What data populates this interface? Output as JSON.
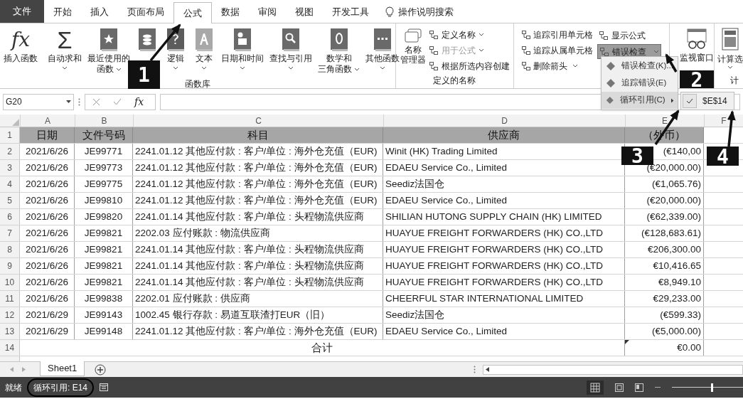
{
  "tabs": [
    {
      "label": "文件",
      "kind": "file",
      "selected": false
    },
    {
      "label": "开始",
      "kind": "tab",
      "selected": false
    },
    {
      "label": "插入",
      "kind": "tab",
      "selected": false
    },
    {
      "label": "页面布局",
      "kind": "tab",
      "selected": false
    },
    {
      "label": "公式",
      "kind": "tab",
      "selected": true
    },
    {
      "label": "数据",
      "kind": "tab",
      "selected": false
    },
    {
      "label": "审阅",
      "kind": "tab",
      "selected": false
    },
    {
      "label": "视图",
      "kind": "tab",
      "selected": false
    },
    {
      "label": "开发工具",
      "kind": "tab",
      "selected": false
    }
  ],
  "search_hint": "操作说明搜索",
  "function_library": {
    "label": "函数库",
    "buttons": [
      {
        "label": "插入函数",
        "glyph": "fx",
        "caret": false
      },
      {
        "label": "自动求和",
        "glyph": "Σ",
        "caret": true
      },
      {
        "label": "最近使用的",
        "label_2": "函数",
        "caret": true
      },
      {
        "caret": false
      },
      {
        "label": "逻辑",
        "caret": true
      },
      {
        "label": "文本",
        "caret": true
      },
      {
        "label": "日期和时间",
        "caret": true
      },
      {
        "label": "查找与引用",
        "caret": true
      },
      {
        "label": "数学和",
        "label_2": "三角函数",
        "caret": true
      },
      {
        "label": "其他函数",
        "caret": true
      }
    ]
  },
  "defined_names": {
    "label": "定义的名称",
    "manager": [
      "名称",
      "管理器"
    ],
    "items": [
      {
        "label": "定义名称",
        "caret": true,
        "disabled": false
      },
      {
        "label": "用于公式",
        "caret": true,
        "disabled": true
      },
      {
        "label": "根据所选内容创建",
        "caret": false,
        "disabled": false
      }
    ]
  },
  "auditing": {
    "left": [
      {
        "label": "追踪引用单元格",
        "caret": false
      },
      {
        "label": "追踪从属单元格",
        "caret": false
      },
      {
        "label": "删除箭头",
        "caret": true
      }
    ],
    "right": [
      {
        "label": "显示公式",
        "caret": false,
        "pressed": false
      },
      {
        "label": "错误检查",
        "caret": true,
        "pressed": true
      }
    ]
  },
  "watch_window": "监视窗口",
  "calculation": {
    "label": "计算选",
    "group_label": "计"
  },
  "error_menu": {
    "items": [
      {
        "label": "错误检查(K)...",
        "submenu": false
      },
      {
        "label": "追踪错误(E)",
        "submenu": false
      },
      {
        "label": "循环引用(C)",
        "submenu": true
      }
    ],
    "submenu": [
      {
        "label": "$E$14",
        "checked": true
      }
    ]
  },
  "formula_bar": {
    "name_box": "G20",
    "fx": "fx"
  },
  "columns": [
    "A",
    "B",
    "C",
    "D",
    "E",
    "F"
  ],
  "rows": [
    {
      "number": "1",
      "kind": "header",
      "cells": [
        "日期",
        "文件号码",
        "科目",
        "供应商",
        "（外币）"
      ]
    },
    {
      "number": "2",
      "kind": "data",
      "cells": [
        "2021/6/26",
        "JE99771",
        "2241.01.12 其他应付款 : 客户/单位 : 海外仓充值（EUR)",
        "Winit (HK) Trading Limited",
        "(€140,00"
      ]
    },
    {
      "number": "3",
      "kind": "data",
      "cells": [
        "2021/6/26",
        "JE99773",
        "2241.01.12 其他应付款 : 客户/单位 : 海外仓充值（EUR)",
        "EDAEU Service Co., Limited",
        "(€20,000.00)"
      ]
    },
    {
      "number": "4",
      "kind": "data",
      "cells": [
        "2021/6/26",
        "JE99775",
        "2241.01.12 其他应付款 : 客户/单位 : 海外仓充值（EUR)",
        "Seediz法国仓",
        "(€1,065.76)"
      ]
    },
    {
      "number": "5",
      "kind": "data",
      "cells": [
        "2021/6/26",
        "JE99810",
        "2241.01.12 其他应付款 : 客户/单位 : 海外仓充值（EUR)",
        "EDAEU Service Co., Limited",
        "(€20,000.00)"
      ]
    },
    {
      "number": "6",
      "kind": "data",
      "cells": [
        "2021/6/26",
        "JE99820",
        "2241.01.14 其他应付款 : 客户/单位 : 头程物流供应商",
        "SHILIAN HUTONG SUPPLY CHAIN (HK) LIMITED",
        "(€62,339.00)"
      ]
    },
    {
      "number": "7",
      "kind": "data",
      "cells": [
        "2021/6/26",
        "JE99821",
        "2202.03 应付账款 : 物流供应商",
        "HUAYUE FREIGHT FORWARDERS (HK) CO.,LTD",
        "(€128,683.61)"
      ]
    },
    {
      "number": "8",
      "kind": "data",
      "cells": [
        "2021/6/26",
        "JE99821",
        "2241.01.14 其他应付款 : 客户/单位 : 头程物流供应商",
        "HUAYUE FREIGHT FORWARDERS (HK) CO.,LTD",
        "€206,300.00"
      ]
    },
    {
      "number": "9",
      "kind": "data",
      "cells": [
        "2021/6/26",
        "JE99821",
        "2241.01.14 其他应付款 : 客户/单位 : 头程物流供应商",
        "HUAYUE FREIGHT FORWARDERS (HK) CO.,LTD",
        "€10,416.65"
      ]
    },
    {
      "number": "10",
      "kind": "data",
      "cells": [
        "2021/6/26",
        "JE99821",
        "2241.01.14 其他应付款 : 客户/单位 : 头程物流供应商",
        "HUAYUE FREIGHT FORWARDERS (HK) CO.,LTD",
        "€8,949.10"
      ]
    },
    {
      "number": "11",
      "kind": "data",
      "cells": [
        "2021/6/26",
        "JE99838",
        "2202.01 应付账款 : 供应商",
        "CHEERFUL STAR INTERNATIONAL LIMITED",
        "€29,233.00"
      ]
    },
    {
      "number": "12",
      "kind": "data",
      "cells": [
        "2021/6/29",
        "JE99143",
        "1002.45 银行存款 : 易道互联渣打EUR（旧）",
        "Seediz法国仓",
        "(€599.33)"
      ]
    },
    {
      "number": "13",
      "kind": "data",
      "cells": [
        "2021/6/29",
        "JE99148",
        "2241.01.12 其他应付款 : 客户/单位 : 海外仓充值（EUR)",
        "EDAEU Service Co., Limited",
        "(€5,000.00)"
      ]
    },
    {
      "number": "14",
      "kind": "total",
      "cells": [
        "合计",
        "€0.00"
      ],
      "error_flag": true
    }
  ],
  "sheet_tabs": [
    {
      "label": "Sheet1",
      "selected": true
    }
  ],
  "status_bar": {
    "ready": "就绪",
    "circular": "循环引用: E14",
    "zoom": {
      "level": 0.55
    }
  },
  "callouts": [
    {
      "number": "1"
    },
    {
      "number": "2"
    },
    {
      "number": "3"
    },
    {
      "number": "4"
    }
  ]
}
